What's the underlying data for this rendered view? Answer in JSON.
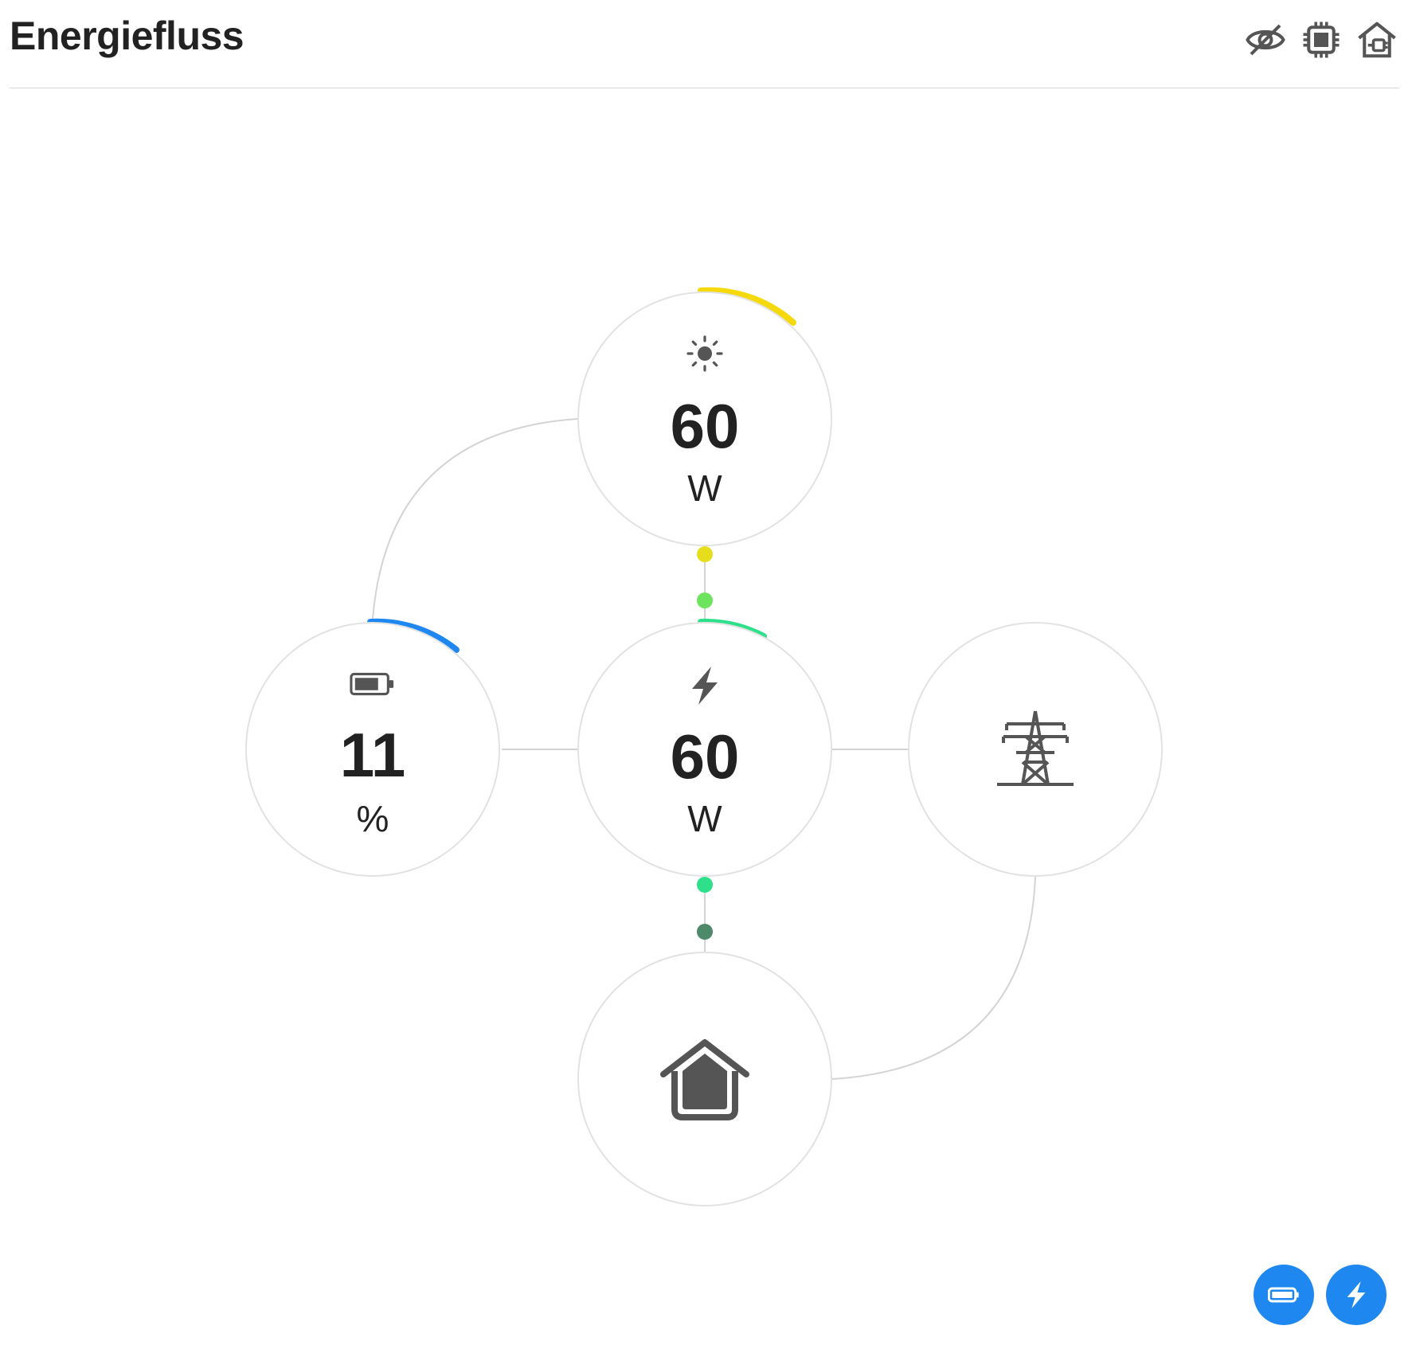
{
  "header": {
    "title": "Energiefluss",
    "actions": [
      {
        "icon": "eye-off-icon"
      },
      {
        "icon": "chip-icon"
      },
      {
        "icon": "home-plug-icon"
      }
    ]
  },
  "nodes": {
    "solar": {
      "icon": "sun-icon",
      "value": "60",
      "unit": "W",
      "accent": "#f5d90a"
    },
    "battery": {
      "icon": "battery-icon",
      "value": "11",
      "unit": "%",
      "accent": "#1e88f0"
    },
    "inverter": {
      "icon": "lightning-icon",
      "value": "60",
      "unit": "W",
      "accent": "#2ee08a"
    },
    "grid": {
      "icon": "power-tower-icon"
    },
    "house": {
      "icon": "house-icon"
    }
  },
  "flow_dots": [
    {
      "between": "solar-inverter",
      "color": "#e6de1a"
    },
    {
      "between": "solar-inverter",
      "color": "#6ee35e"
    },
    {
      "between": "inverter-house",
      "color": "#2ee08a"
    },
    {
      "between": "inverter-house",
      "color": "#4e8a6a"
    }
  ],
  "fabs": [
    {
      "icon": "battery-icon"
    },
    {
      "icon": "lightning-icon"
    }
  ],
  "colors": {
    "fab": "#1e88f0",
    "line": "#d4d4d4",
    "ring": "#e2e2e2",
    "icon": "#555555"
  }
}
